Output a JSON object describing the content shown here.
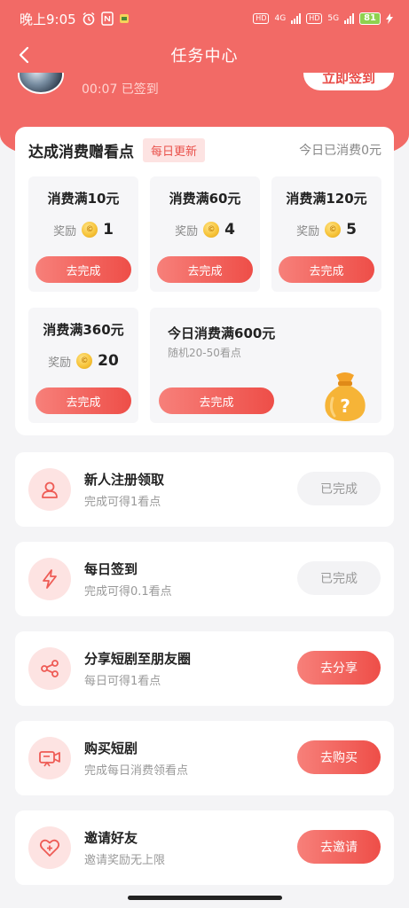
{
  "status_bar": {
    "time": "晚上9:05",
    "network_1": "4G",
    "network_2": "5G",
    "hd_label": "HD",
    "battery": "81"
  },
  "header": {
    "title": "任务中心",
    "signed_text": "00:07 已签到",
    "sign_button": "立即签到"
  },
  "consume": {
    "title": "达成消费赠看点",
    "badge": "每日更新",
    "today_spent": "今日已消费0元",
    "reward_label": "奖励",
    "tiles": [
      {
        "title": "消费满10元",
        "reward": "1",
        "button": "去完成"
      },
      {
        "title": "消费满60元",
        "reward": "4",
        "button": "去完成"
      },
      {
        "title": "消费满120元",
        "reward": "5",
        "button": "去完成"
      },
      {
        "title": "消费满360元",
        "reward": "20",
        "button": "去完成"
      }
    ],
    "big_tile": {
      "title": "今日消费满600元",
      "subtitle": "随机20-50看点",
      "button": "去完成"
    }
  },
  "tasks": [
    {
      "title": "新人注册领取",
      "subtitle": "完成可得1看点",
      "button": "已完成",
      "icon": "user-icon",
      "state": "done"
    },
    {
      "title": "每日签到",
      "subtitle": "完成可得0.1看点",
      "button": "已完成",
      "icon": "lightning-icon",
      "state": "done"
    },
    {
      "title": "分享短剧至朋友圈",
      "subtitle": "每日可得1看点",
      "button": "去分享",
      "icon": "share-icon",
      "state": "go"
    },
    {
      "title": "购买短剧",
      "subtitle": "完成每日消费领看点",
      "button": "去购买",
      "icon": "video-icon",
      "state": "go"
    },
    {
      "title": "邀请好友",
      "subtitle": "邀请奖励无上限",
      "button": "去邀请",
      "icon": "heart-plus-icon",
      "state": "go"
    }
  ],
  "colors": {
    "primary": "#f26a66",
    "button_gradient_start": "#f7807a",
    "button_gradient_end": "#ee4e48",
    "badge_bg": "#fde3e2"
  }
}
